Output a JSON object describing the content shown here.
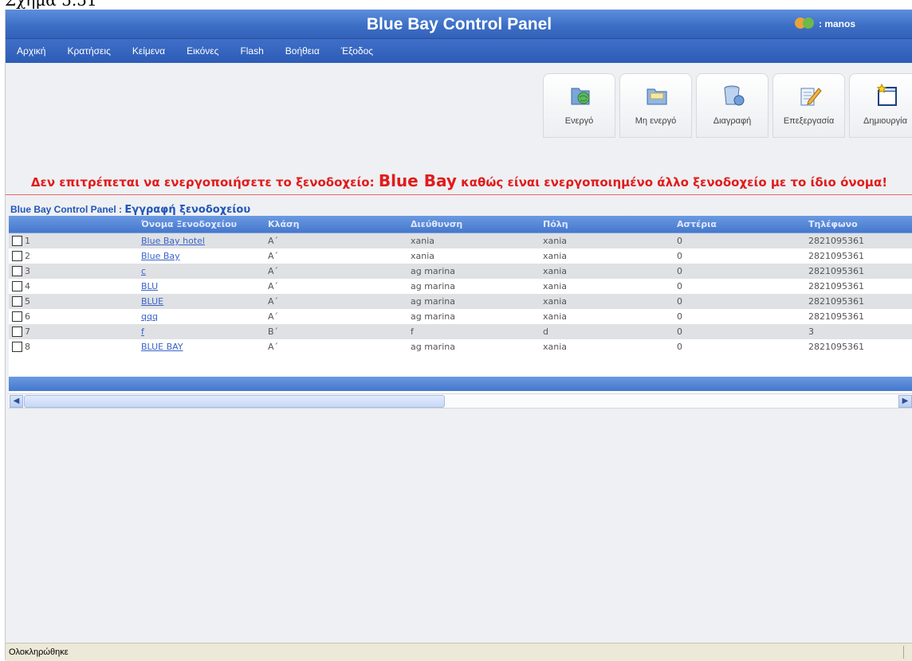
{
  "caption": "Σχήμα 5.51",
  "window": {
    "title": "Blue Bay Control Panel",
    "user_label": ": manos"
  },
  "menu": [
    "Αρχική",
    "Κρατήσεις",
    "Κείμενα",
    "Εικόνες",
    "Flash",
    "Βοήθεια",
    "Έξοδος"
  ],
  "toolbar": [
    {
      "label": "Ενεργό",
      "icon": "globe-folder-icon"
    },
    {
      "label": "Μη ενεργό",
      "icon": "folder-icon"
    },
    {
      "label": "Διαγραφή",
      "icon": "recycle-bin-icon"
    },
    {
      "label": "Επεξεργασία",
      "icon": "edit-pencil-icon"
    },
    {
      "label": "Δημιουργία",
      "icon": "new-star-icon"
    }
  ],
  "error": {
    "prefix": "Δεν επιτρέπεται να ενεργοποιήσετε το ξενοδοχείο: ",
    "hotel": "Blue Bay",
    "suffix": " καθώς είναι ενεργοποιημένο άλλο ξενοδοχείο με το ίδιο όνομα!"
  },
  "breadcrumb": {
    "app": "Blue Bay Control Panel : ",
    "page": "Εγγραφή ξενοδοχείου"
  },
  "table": {
    "headers": [
      "",
      "Όνομα Ξενοδοχείου",
      "Κλάση",
      "Διεύθυνση",
      "Πόλη",
      "Αστέρια",
      "Τηλέφωνο"
    ],
    "rows": [
      [
        "1",
        "Blue Bay hotel",
        "A΄",
        "xania",
        "xania",
        "0",
        "2821095361"
      ],
      [
        "2",
        "Blue Bay",
        "A΄",
        "xania",
        "xania",
        "0",
        "2821095361"
      ],
      [
        "3",
        "c",
        "A΄",
        "ag marina",
        "xania",
        "0",
        "2821095361"
      ],
      [
        "4",
        "BLU",
        "A΄",
        "ag marina",
        "xania",
        "0",
        "2821095361"
      ],
      [
        "5",
        "BLUE",
        "A΄",
        "ag marina",
        "xania",
        "0",
        "2821095361"
      ],
      [
        "6",
        "qqq",
        "A΄",
        "ag marina",
        "xania",
        "0",
        "2821095361"
      ],
      [
        "7",
        "f",
        "B΄",
        "f",
        "d",
        "0",
        "3"
      ],
      [
        "8",
        "BLUE BAY",
        "A΄",
        "ag marina",
        "xania",
        "0",
        "2821095361"
      ]
    ]
  },
  "status": {
    "text": "Ολοκληρώθηκε"
  },
  "colors": {
    "header_blue": "#3d6fc6",
    "error_red": "#e21b1b",
    "link": "#3a63c9"
  }
}
